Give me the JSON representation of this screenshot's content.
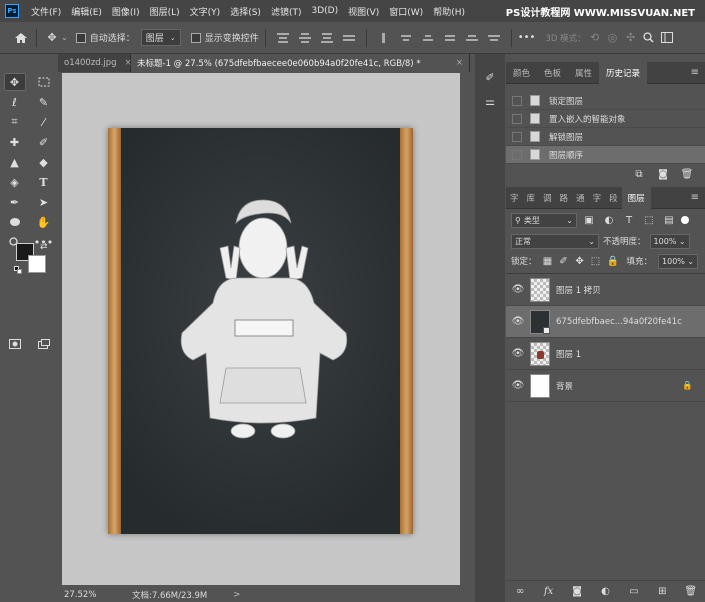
{
  "menubar": {
    "logo": "Ps",
    "items": [
      "文件(F)",
      "编辑(E)",
      "图像(I)",
      "图层(L)",
      "文字(Y)",
      "选择(S)",
      "滤镜(T)",
      "3D(D)",
      "视图(V)",
      "窗口(W)",
      "帮助(H)"
    ],
    "watermark": "PS设计教程网 WWW.MISSVUAN.NET"
  },
  "options": {
    "auto_select_label": "自动选择：",
    "auto_select_value": "图层",
    "show_transform_label": "显示变换控件",
    "more": "•••",
    "mode_3d_label": "3D 模式："
  },
  "tabs": [
    {
      "label": "o1400zd.jpg",
      "close": "×"
    },
    {
      "label": "未标题-1 @ 27.5% (675dfebfbaecee0e060b94a0f20fe41c, RGB/8) *",
      "close": "×"
    }
  ],
  "status": {
    "zoom": "27.52%",
    "doc_info": "文档:7.66M/23.9M",
    "arrow": ">"
  },
  "history_panel": {
    "tabs": [
      "颜色",
      "色板",
      "属性",
      "历史记录"
    ],
    "active_tab": "历史记录",
    "items": [
      "锁定图层",
      "置入嵌入的智能对象",
      "解锁图层",
      "图层顺序"
    ],
    "selected_index": 3
  },
  "layers_panel": {
    "tabs": [
      "字",
      "库",
      "调",
      "路",
      "通",
      "字",
      "段",
      "图层"
    ],
    "active_tab": "图层",
    "filter_label": "类型",
    "blend_mode": "正常",
    "opacity_label": "不透明度：",
    "opacity_value": "100%",
    "lock_label": "锁定：",
    "fill_label": "填充：",
    "fill_value": "100%",
    "layers": [
      {
        "name": "图层 1 拷贝",
        "selected": false
      },
      {
        "name": "675dfebfbaec...94a0f20fe41c",
        "selected": true
      },
      {
        "name": "图层 1",
        "selected": false
      },
      {
        "name": "背景",
        "selected": false
      }
    ]
  },
  "colors": {
    "accent": "#31a8ff",
    "doc_bg": "#2b3033",
    "wood": "#c08a4a"
  }
}
